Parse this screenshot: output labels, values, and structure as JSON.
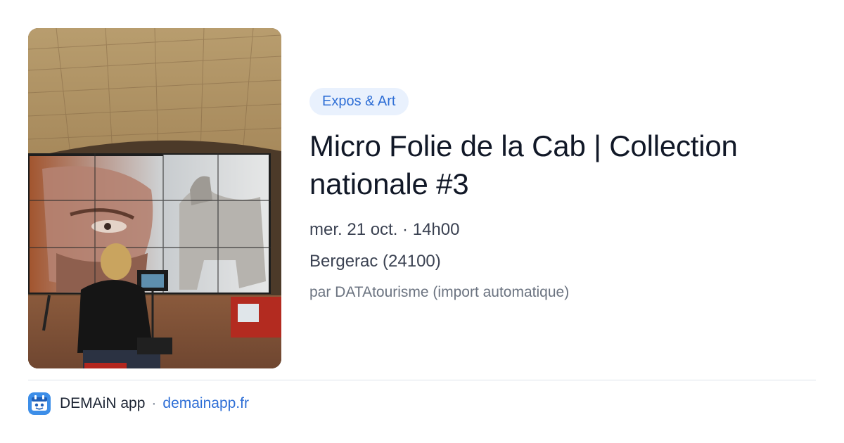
{
  "photo": {
    "alt": "Micro Folie de la Cab | Collection nationale #3"
  },
  "event": {
    "category": "Expos & Art",
    "title": "Micro Folie de la Cab | Collection nationale #3",
    "date": "mer. 21 oct. · 14h00",
    "location": "Bergerac (24100)",
    "source": "par DATAtourisme (import automatique)"
  },
  "footer": {
    "app_icon": "demain-app-icon",
    "app_name": "DEMAiN app",
    "separator": "·",
    "link_text": "demainapp.fr"
  },
  "colors": {
    "accent": "#2f6fd6",
    "badge_bg": "#e9f1fd",
    "title": "#111827",
    "muted": "#6b7380"
  }
}
